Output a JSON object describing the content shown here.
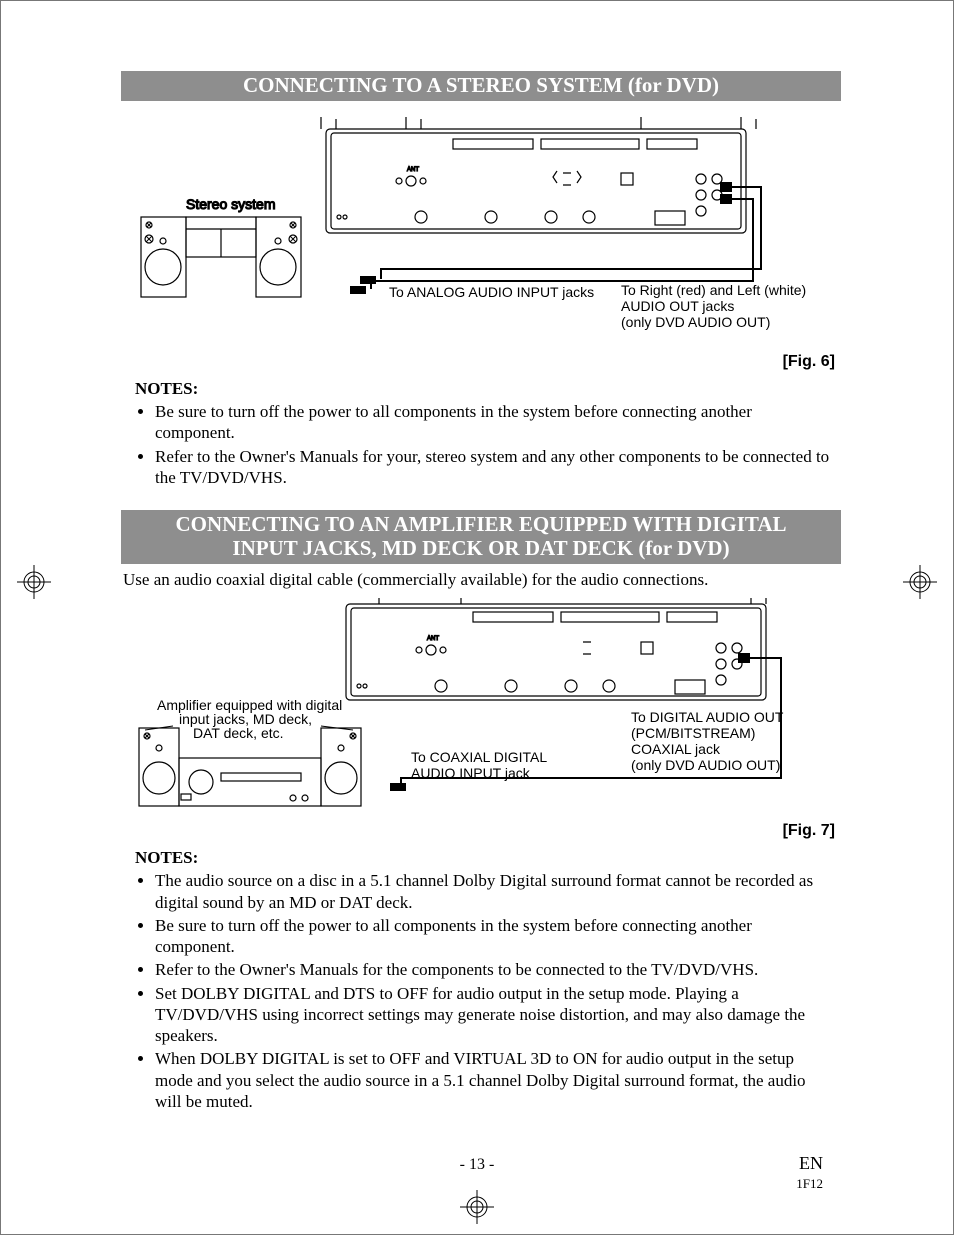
{
  "section1": {
    "title": "CONNECTING TO A STEREO SYSTEM (for DVD)",
    "diagram": {
      "stereo_label": "Stereo system",
      "analog_label": "To ANALOG AUDIO INPUT jacks",
      "audio_out_line1": "To Right (red) and Left (white)",
      "audio_out_line2": "AUDIO OUT jacks",
      "audio_out_line3": "(only DVD AUDIO OUT)",
      "ant_label": "ANT"
    },
    "fig": "[Fig. 6]",
    "notes_heading": "NOTES:",
    "notes": [
      "Be sure to turn off the power to all components in the system before connecting another component.",
      "Refer to the Owner's Manuals for your, stereo system and any other components to be connected to the TV/DVD/VHS."
    ]
  },
  "section2": {
    "title_line1": "CONNECTING TO AN AMPLIFIER EQUIPPED WITH DIGITAL",
    "title_line2": "INPUT JACKS, MD DECK OR DAT DECK (for DVD)",
    "intro": "Use an audio coaxial digital cable (commercially available) for the audio connections.",
    "diagram": {
      "amp_label_line1": "Amplifier equipped with digital",
      "amp_label_line2": "input jacks, MD deck,",
      "amp_label_line3": "DAT deck, etc.",
      "coax_label_line1": "To COAXIAL DIGITAL",
      "coax_label_line2": "AUDIO INPUT jack",
      "digital_out_line1": "To DIGITAL AUDIO OUT",
      "digital_out_line2": "(PCM/BITSTREAM)",
      "digital_out_line3": "COAXIAL jack",
      "digital_out_line4": "(only DVD AUDIO OUT)",
      "ant_label": "ANT"
    },
    "fig": "[Fig. 7]",
    "notes_heading": "NOTES:",
    "notes": [
      "The audio source on a disc in a 5.1 channel Dolby Digital surround format cannot be recorded as digital sound by an MD or DAT deck.",
      "Be sure to turn off the power to all components in the system before connecting another component.",
      "Refer to the Owner's Manuals for the components to be connected to the TV/DVD/VHS.",
      "Set DOLBY DIGITAL and DTS to OFF for audio output in the setup mode. Playing a TV/DVD/VHS using incorrect settings may generate noise distortion, and may also damage the speakers.",
      "When DOLBY DIGITAL is set to OFF and VIRTUAL 3D to ON for audio output in the setup mode and you select the audio source in a 5.1 channel Dolby Digital surround format, the audio will be muted."
    ]
  },
  "footer": {
    "page": "- 13 -",
    "lang": "EN",
    "code": "1F12"
  }
}
